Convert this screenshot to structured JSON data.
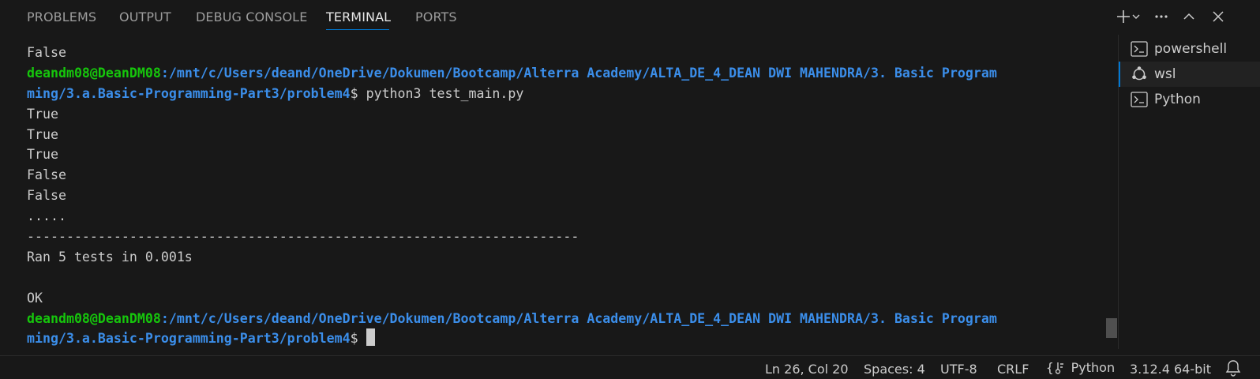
{
  "panel": {
    "tabs": [
      {
        "label": "PROBLEMS",
        "active": false
      },
      {
        "label": "OUTPUT",
        "active": false
      },
      {
        "label": "DEBUG CONSOLE",
        "active": false
      },
      {
        "label": "TERMINAL",
        "active": true
      },
      {
        "label": "PORTS",
        "active": false
      }
    ],
    "actions": [
      "new-terminal",
      "terminal-dropdown",
      "more-actions",
      "maximize-panel",
      "close-panel"
    ]
  },
  "terminal": {
    "lines": [
      {
        "text": "False"
      },
      {
        "user": "deandm08@DeanDM08",
        "path": ":/mnt/c/Users/deand/OneDrive/Dokumen/Bootcamp/Alterra Academy/ALTA_DE_4_DEAN DWI MAHENDRA/3. Basic Program"
      },
      {
        "path": "ming/3.a.Basic-Programming-Part3/problem4",
        "rest": "$ python3 test_main.py"
      },
      {
        "text": "True"
      },
      {
        "text": "True"
      },
      {
        "text": "True"
      },
      {
        "text": "False"
      },
      {
        "text": "False"
      },
      {
        "text": "....."
      },
      {
        "text": "----------------------------------------------------------------------"
      },
      {
        "text": "Ran 5 tests in 0.001s"
      },
      {
        "text": ""
      },
      {
        "text": "OK"
      },
      {
        "user": "deandm08@DeanDM08",
        "path": ":/mnt/c/Users/deand/OneDrive/Dokumen/Bootcamp/Alterra Academy/ALTA_DE_4_DEAN DWI MAHENDRA/3. Basic Program"
      },
      {
        "path": "ming/3.a.Basic-Programming-Part3/problem4",
        "rest": "$ ",
        "cursor": true
      }
    ]
  },
  "terminal_list": [
    {
      "label": "powershell",
      "icon": "terminal-icon",
      "selected": false
    },
    {
      "label": "wsl",
      "icon": "ubuntu-icon",
      "selected": true
    },
    {
      "label": "Python",
      "icon": "terminal-icon",
      "selected": false
    }
  ],
  "statusbar": {
    "position": "Ln 26, Col 20",
    "spaces": "Spaces: 4",
    "encoding": "UTF-8",
    "eol": "CRLF",
    "language": "Python",
    "interpreter": "3.12.4 64-bit"
  },
  "colors": {
    "background": "#181818",
    "accent": "#0078d4",
    "prompt_user": "#16c60c",
    "prompt_path": "#3b8eea"
  }
}
